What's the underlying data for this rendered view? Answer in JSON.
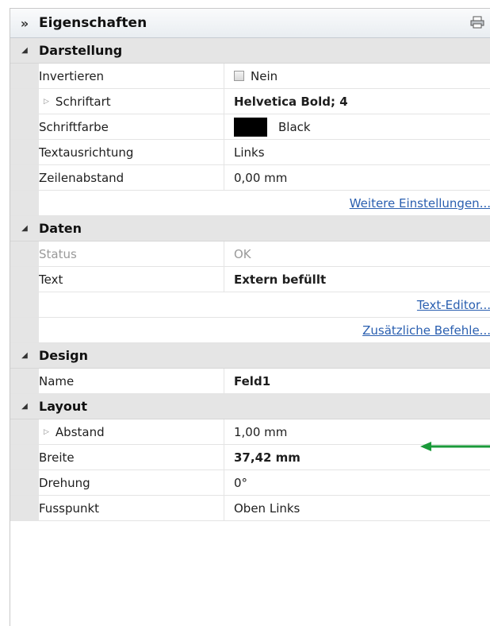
{
  "panel": {
    "title": "Eigenschaften",
    "collapse_glyph": "»",
    "print_icon": "printer-icon"
  },
  "sections": {
    "darstellung": {
      "title": "Darstellung",
      "invertieren": {
        "label": "Invertieren",
        "value": "Nein"
      },
      "schriftart": {
        "label": "Schriftart",
        "value": "Helvetica Bold; 4"
      },
      "schriftfarbe": {
        "label": "Schriftfarbe",
        "value": "Black",
        "color": "#000000"
      },
      "textausrichtung": {
        "label": "Textausrichtung",
        "value": "Links"
      },
      "zeilenabstand": {
        "label": "Zeilenabstand",
        "value": "0,00 mm"
      },
      "more_link": "Weitere Einstellungen..."
    },
    "daten": {
      "title": "Daten",
      "status": {
        "label": "Status",
        "value": "OK"
      },
      "text": {
        "label": "Text",
        "value": "Extern befüllt"
      },
      "text_editor_link": "Text-Editor...",
      "extra_link": "Zusätzliche Befehle..."
    },
    "design": {
      "title": "Design",
      "name": {
        "label": "Name",
        "value": "Feld1"
      }
    },
    "layout": {
      "title": "Layout",
      "abstand": {
        "label": "Abstand",
        "value": "1,00 mm"
      },
      "breite": {
        "label": "Breite",
        "value": "37,42 mm"
      },
      "drehung": {
        "label": "Drehung",
        "value": "0°"
      },
      "fusspunkt": {
        "label": "Fusspunkt",
        "value": "Oben Links"
      }
    }
  },
  "annotation": {
    "arrow_color": "#1a9a3a"
  }
}
